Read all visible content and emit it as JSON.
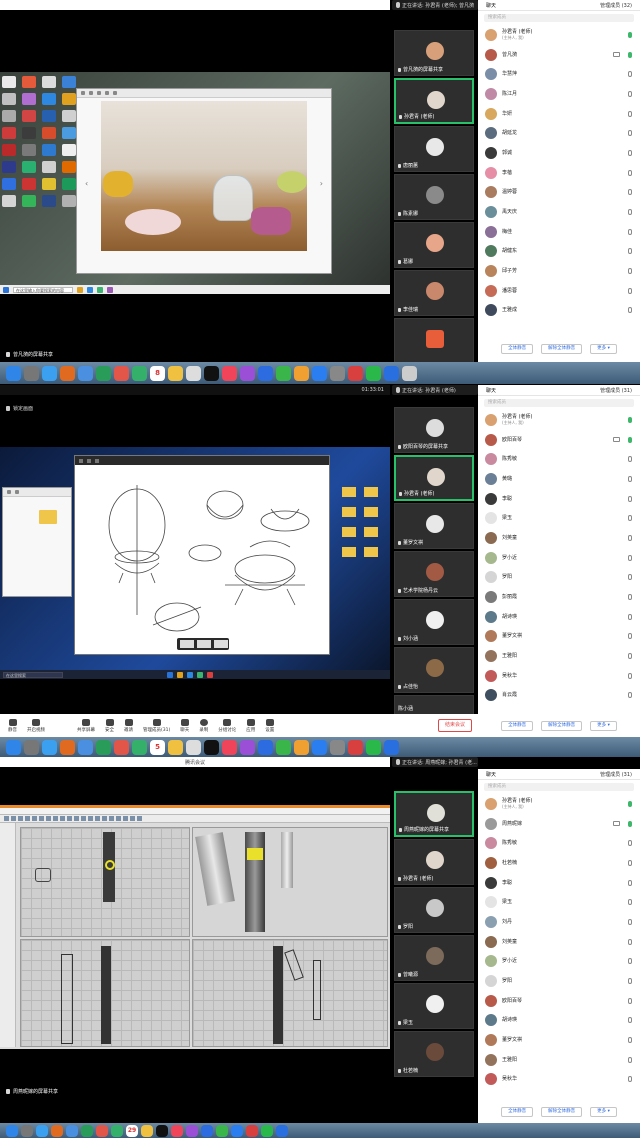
{
  "colors": {
    "accent_green": "#29c06a",
    "link_blue": "#2f6be0",
    "end_red": "#e04848"
  },
  "panel1": {
    "speaking": "正在讲话: 孙君青 (老师); 曾凡漪",
    "share_label": "曾凡漪的屏幕共享",
    "taskbar_search": "在这里输入你要搜索的内容",
    "video_tiles": [
      "曾凡漪的屏幕共享",
      "孙君青 (老师)",
      "唐丽蕙",
      "陈素娜",
      "葛娜",
      "李佳瑞",
      ""
    ],
    "members_tab": "聊天",
    "members_header": "管理成员 (32)",
    "search_placeholder": "搜索成员",
    "members": [
      {
        "name": "孙君青 (老师)",
        "sub": "(主持人, 我)",
        "color": "#d9a070"
      },
      {
        "name": "曾凡漪",
        "sub": "",
        "color": "#b85a4a"
      },
      {
        "name": "华慧萍",
        "sub": "",
        "color": "#7b8ea8"
      },
      {
        "name": "陈江月",
        "sub": "",
        "color": "#c08aa6"
      },
      {
        "name": "华妍",
        "sub": "",
        "color": "#d7a85e"
      },
      {
        "name": "胡延龙",
        "sub": "",
        "color": "#5a6c7d"
      },
      {
        "name": "郭诚",
        "sub": "",
        "color": "#3a3a3a"
      },
      {
        "name": "李蓓",
        "sub": "",
        "color": "#e58ea5"
      },
      {
        "name": "温婷蓉",
        "sub": "",
        "color": "#a97c60"
      },
      {
        "name": "禹天庆",
        "sub": "",
        "color": "#6a8f9a"
      },
      {
        "name": "梅佳",
        "sub": "",
        "color": "#8a6f97"
      },
      {
        "name": "胡健东",
        "sub": "",
        "color": "#4f7a5e"
      },
      {
        "name": "邱子芳",
        "sub": "",
        "color": "#b9835b"
      },
      {
        "name": "潘思蓉",
        "sub": "",
        "color": "#c66b55"
      },
      {
        "name": "王雅成",
        "sub": "",
        "color": "#3f4a5c"
      }
    ],
    "btn_mute_all": "全体静音",
    "btn_unmute_all": "解除全体静音",
    "btn_more": "更多 ▾"
  },
  "panel2": {
    "clock": "01:33:01",
    "lock_label": "锁定画面",
    "speaking": "正在讲话: 孙君青 (老师)",
    "share_label": "",
    "taskbar_search": "在这里搜索",
    "video_tiles": [
      "欧阳百琴的屏幕共享",
      "孙君青 (老师)",
      "董罗文祺",
      "艺术学院杨丹云",
      "刘小涵",
      "占佳怡",
      "陈小涵"
    ],
    "members_tab": "聊天",
    "members_header": "管理成员 (31)",
    "search_placeholder": "搜索成员",
    "members": [
      {
        "name": "孙君青 (老师)",
        "sub": "(主持人, 我)",
        "color": "#d9a070"
      },
      {
        "name": "欧阳百琴",
        "sub": "",
        "color": "#b85a4a"
      },
      {
        "name": "陈秀敏",
        "sub": "",
        "color": "#c98aa0"
      },
      {
        "name": "黄璐",
        "sub": "",
        "color": "#6b7f96"
      },
      {
        "name": "李聪",
        "sub": "",
        "color": "#3a3a3a"
      },
      {
        "name": "梁玉",
        "sub": "",
        "color": "#e4e4e4"
      },
      {
        "name": "刘英童",
        "sub": "",
        "color": "#8a6a50"
      },
      {
        "name": "罗小近",
        "sub": "",
        "color": "#a6b88d"
      },
      {
        "name": "罗阳",
        "sub": "",
        "color": "#d5d5d5"
      },
      {
        "name": "彭丽霞",
        "sub": "",
        "color": "#7a7a7a"
      },
      {
        "name": "胡诗瑛",
        "sub": "",
        "color": "#5c7a8a"
      },
      {
        "name": "董罗文祺",
        "sub": "",
        "color": "#b07a5a"
      },
      {
        "name": "王雅阳",
        "sub": "",
        "color": "#94735c"
      },
      {
        "name": "吴秋华",
        "sub": "",
        "color": "#c25a5a"
      },
      {
        "name": "肖云霞",
        "sub": "",
        "color": "#3f4f5f"
      }
    ],
    "btn_mute_all": "全体静音",
    "btn_unmute_all": "解除全体静音",
    "btn_more": "更多 ▾",
    "toolbar": [
      {
        "label": "静音",
        "icon": "mic-icon"
      },
      {
        "label": "开启视频",
        "icon": "camera-icon"
      },
      {
        "label": "共享屏幕",
        "icon": "share-screen-icon"
      },
      {
        "label": "安全",
        "icon": "shield-icon"
      },
      {
        "label": "邀请",
        "icon": "invite-icon"
      },
      {
        "label": "管理成员(31)",
        "icon": "members-icon"
      },
      {
        "label": "聊天",
        "icon": "chat-icon"
      },
      {
        "label": "录制",
        "icon": "record-icon"
      },
      {
        "label": "分组讨论",
        "icon": "breakout-icon"
      },
      {
        "label": "应用",
        "icon": "apps-icon"
      },
      {
        "label": "设置",
        "icon": "settings-icon"
      }
    ],
    "end_meeting": "结束会议"
  },
  "panel3": {
    "window_title": "腾讯会议",
    "speaking": "正在讲话: 周燕昵嫁; 孙君青 (老...",
    "share_label": "周燕昵嫁的屏幕共享",
    "video_tiles": [
      "周燕昵嫁的屏幕共享",
      "孙君青 (老师)",
      "罗阳",
      "曾曦源",
      "梁玉",
      "杜若楠"
    ],
    "members_tab": "聊天",
    "members_header": "管理成员 (31)",
    "search_placeholder": "搜索成员",
    "members": [
      {
        "name": "孙君青 (老师)",
        "sub": "(主持人, 我)",
        "color": "#d9a070"
      },
      {
        "name": "周燕昵嫁",
        "sub": "",
        "color": "#9a9a9a"
      },
      {
        "name": "陈秀敏",
        "sub": "",
        "color": "#c98aa0"
      },
      {
        "name": "杜若楠",
        "sub": "",
        "color": "#a06040"
      },
      {
        "name": "李聪",
        "sub": "",
        "color": "#3a3a3a"
      },
      {
        "name": "梁玉",
        "sub": "",
        "color": "#e4e4e4"
      },
      {
        "name": "刘丹",
        "sub": "",
        "color": "#8aa0b0"
      },
      {
        "name": "刘英童",
        "sub": "",
        "color": "#8a6a50"
      },
      {
        "name": "罗小近",
        "sub": "",
        "color": "#a6b88d"
      },
      {
        "name": "罗阳",
        "sub": "",
        "color": "#d5d5d5"
      },
      {
        "name": "欧阳百琴",
        "sub": "",
        "color": "#b85a4a"
      },
      {
        "name": "胡诗瑛",
        "sub": "",
        "color": "#5c7a8a"
      },
      {
        "name": "董罗文祺",
        "sub": "",
        "color": "#b07a5a"
      },
      {
        "name": "王雅阳",
        "sub": "",
        "color": "#94735c"
      },
      {
        "name": "吴秋华",
        "sub": "",
        "color": "#c25a5a"
      }
    ],
    "btn_mute_all": "全体静音",
    "btn_unmute_all": "解除全体静音",
    "btn_more": "更多 ▾"
  },
  "dock": {
    "calendar_days": [
      "8",
      "5",
      "29"
    ]
  }
}
